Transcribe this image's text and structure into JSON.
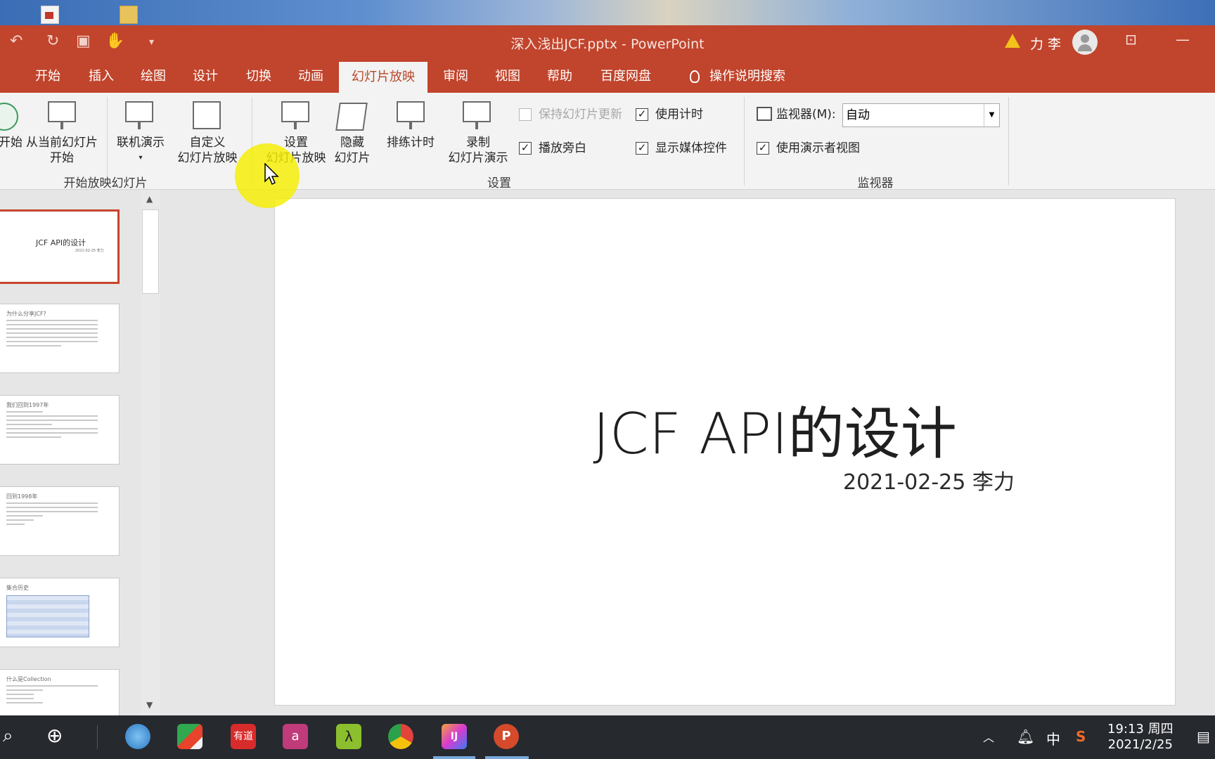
{
  "window": {
    "title": "深入浅出JCF.pptx  -  PowerPoint",
    "user": "力 李"
  },
  "tabs": [
    {
      "label": "开始"
    },
    {
      "label": "插入"
    },
    {
      "label": "绘图"
    },
    {
      "label": "设计"
    },
    {
      "label": "切换"
    },
    {
      "label": "动画"
    },
    {
      "label": "幻灯片放映",
      "active": true
    },
    {
      "label": "审阅"
    },
    {
      "label": "视图"
    },
    {
      "label": "帮助"
    },
    {
      "label": "百度网盘"
    },
    {
      "label": "操作说明搜索"
    }
  ],
  "ribbon": {
    "start": {
      "from_start": "开始",
      "from_current_1": "从当前幻灯片",
      "from_current_2": "开始",
      "online": "联机演示",
      "custom_1": "自定义",
      "custom_2": "幻灯片放映",
      "group": "开始放映幻灯片"
    },
    "setup": {
      "setup_1": "设置",
      "setup_2": "幻灯片放映",
      "hide_1": "隐藏",
      "hide_2": "幻灯片",
      "rehearse": "排练计时",
      "record_1": "录制",
      "record_2": "幻灯片演示",
      "keep_updated": "保持幻灯片更新",
      "use_timings": "使用计时",
      "play_narration": "播放旁白",
      "show_media": "显示媒体控件",
      "group": "设置"
    },
    "monitors": {
      "monitor_label": "监视器(M):",
      "monitor_value": "自动",
      "presenter_view": "使用演示者视图",
      "group": "监视器"
    }
  },
  "thumbnails": [
    {
      "title": "JCF API的设计",
      "sub": "2021-02-25 李力"
    },
    {
      "title": "为什么分享JCF?"
    },
    {
      "title": "我们回到1997年"
    },
    {
      "title": "回到1998年"
    },
    {
      "title": "集合历史"
    },
    {
      "title": "什么是Collection"
    }
  ],
  "slide": {
    "title": "JCF API的设计",
    "subtitle": "2021-02-25 李力"
  },
  "taskbar": {
    "ime": "中",
    "time": "19:13 周四",
    "date": "2021/2/25"
  }
}
